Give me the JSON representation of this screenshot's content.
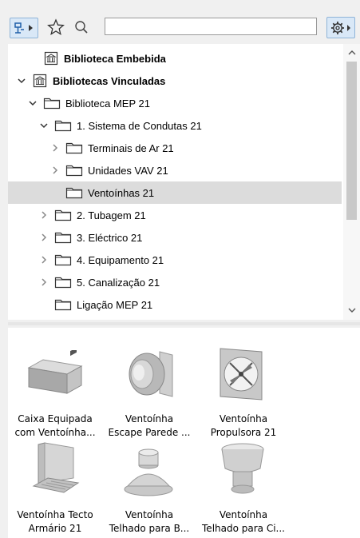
{
  "toolbar": {
    "filter_icon": "library-filter-icon",
    "favorites_icon": "star-icon",
    "search_icon": "search-icon",
    "search_value": "",
    "search_placeholder": "",
    "settings_icon": "gear-icon"
  },
  "tree": {
    "items": [
      {
        "label": "Biblioteca Embebida",
        "bold": true,
        "icon": "library-icon",
        "expander": "none"
      },
      {
        "label": "Bibliotecas Vinculadas",
        "bold": true,
        "icon": "library-icon",
        "expander": "expanded"
      },
      {
        "label": "Biblioteca MEP 21",
        "bold": false,
        "icon": "folder-icon",
        "expander": "expanded"
      },
      {
        "label": "1. Sistema de Condutas 21",
        "bold": false,
        "icon": "folder-icon",
        "expander": "expanded"
      },
      {
        "label": "Terminais de Ar 21",
        "bold": false,
        "icon": "folder-icon",
        "expander": "collapsed"
      },
      {
        "label": "Unidades VAV 21",
        "bold": false,
        "icon": "folder-icon",
        "expander": "collapsed"
      },
      {
        "label": "Ventoínhas 21",
        "bold": false,
        "icon": "folder-icon",
        "expander": "none",
        "selected": true
      },
      {
        "label": "2. Tubagem 21",
        "bold": false,
        "icon": "folder-icon",
        "expander": "collapsed"
      },
      {
        "label": "3. Eléctrico 21",
        "bold": false,
        "icon": "folder-icon",
        "expander": "collapsed"
      },
      {
        "label": "4. Equipamento 21",
        "bold": false,
        "icon": "folder-icon",
        "expander": "collapsed"
      },
      {
        "label": "5. Canalização 21",
        "bold": false,
        "icon": "folder-icon",
        "expander": "collapsed"
      },
      {
        "label": "Ligação MEP 21",
        "bold": false,
        "icon": "folder-icon",
        "expander": "none"
      }
    ]
  },
  "objects": {
    "items": [
      {
        "line1": "Caixa Equipada",
        "line2": "com Ventoínha...",
        "icon": "fan-box-icon"
      },
      {
        "line1": "Ventoínha",
        "line2": "Escape Parede ...",
        "icon": "wall-exhaust-fan-icon"
      },
      {
        "line1": "Ventoínha",
        "line2": "Propulsora 21",
        "icon": "propeller-fan-icon"
      },
      {
        "line1": "Ventoínha Tecto",
        "line2": "Armário 21",
        "icon": "ceiling-cabinet-fan-icon"
      },
      {
        "line1": "Ventoínha",
        "line2": "Telhado para B...",
        "icon": "roof-fan-low-icon"
      },
      {
        "line1": "Ventoínha",
        "line2": "Telhado para Ci...",
        "icon": "roof-fan-high-icon"
      }
    ]
  }
}
